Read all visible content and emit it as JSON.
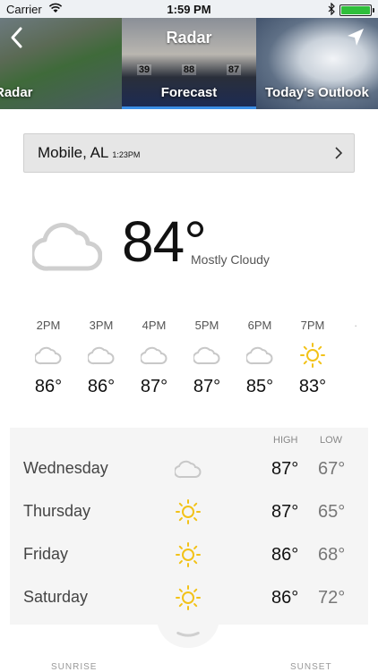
{
  "status_bar": {
    "carrier": "Carrier",
    "time": "1:59 PM"
  },
  "nav": {
    "title": "Radar"
  },
  "tabs": [
    {
      "label": "Radar"
    },
    {
      "label": "Forecast",
      "selected": true
    },
    {
      "label": "Today's Outlook"
    }
  ],
  "forecast_thumb": {
    "columns": [
      "39",
      "88",
      "87"
    ]
  },
  "location": {
    "city": "Mobile, AL",
    "time": "1:23PM"
  },
  "current": {
    "temp": "84°",
    "condition": "Mostly Cloudy",
    "icon": "cloud-icon"
  },
  "hourly": [
    {
      "time": "2PM",
      "temp": "86°",
      "icon": "cloud-icon"
    },
    {
      "time": "3PM",
      "temp": "86°",
      "icon": "cloud-icon"
    },
    {
      "time": "4PM",
      "temp": "87°",
      "icon": "cloud-icon"
    },
    {
      "time": "5PM",
      "temp": "87°",
      "icon": "cloud-icon"
    },
    {
      "time": "6PM",
      "temp": "85°",
      "icon": "cloud-icon"
    },
    {
      "time": "7PM",
      "temp": "83°",
      "icon": "sun-icon"
    }
  ],
  "daily_headers": {
    "high": "HIGH",
    "low": "LOW"
  },
  "daily": [
    {
      "day": "Wednesday",
      "high": "87°",
      "low": "67°",
      "icon": "cloud-icon"
    },
    {
      "day": "Thursday",
      "high": "87°",
      "low": "65°",
      "icon": "sun-icon"
    },
    {
      "day": "Friday",
      "high": "86°",
      "low": "68°",
      "icon": "sun-icon"
    },
    {
      "day": "Saturday",
      "high": "86°",
      "low": "72°",
      "icon": "sun-icon"
    }
  ],
  "footer": {
    "sunrise": "SUNRISE",
    "sunset": "SUNSET"
  },
  "colors": {
    "accent": "#3a8ee6",
    "sun": "#f2c218",
    "cloud": "#c8c8c8"
  }
}
